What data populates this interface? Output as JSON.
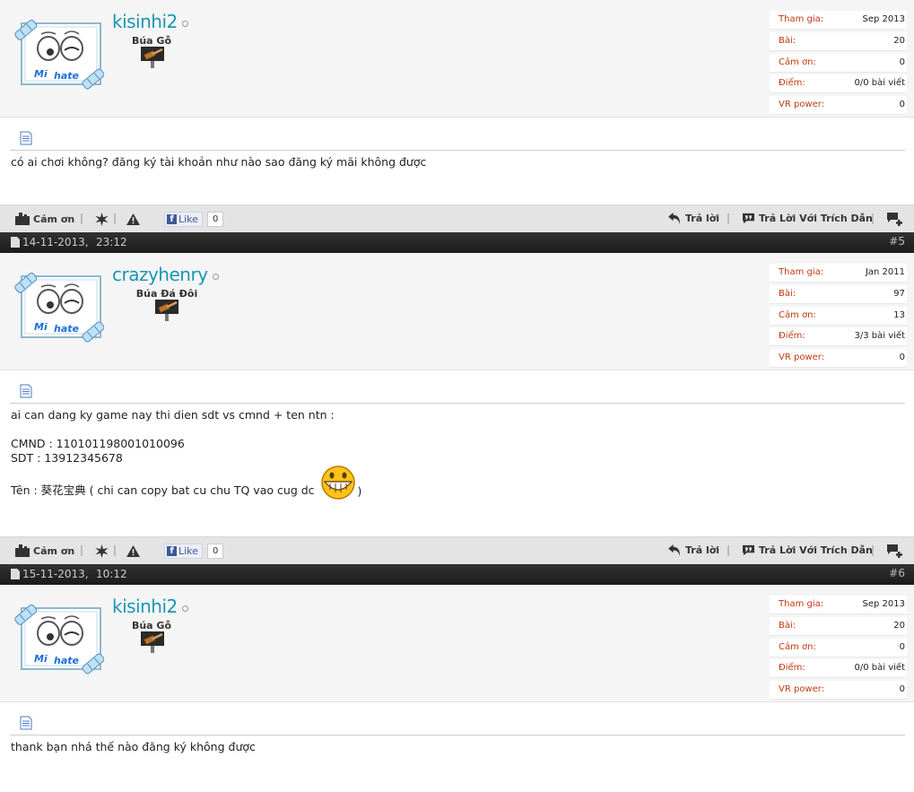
{
  "posts": [
    {
      "username": "kisinhi2",
      "user_title": "Búa Gỗ",
      "stats": [
        {
          "label": "Tham gia:",
          "value": "Sep 2013"
        },
        {
          "label": "Bài:",
          "value": "20"
        },
        {
          "label": "Cảm ơn:",
          "value": "0"
        },
        {
          "label": "Điểm:",
          "value": "0/0 bài viết"
        },
        {
          "label": "VR power:",
          "value": "0"
        }
      ],
      "content": [
        "có ai chơi không? đăng ký tài khoản như nào sao đăng ký mãi không được"
      ]
    },
    {
      "date": "14-11-2013,",
      "time": "23:12",
      "number": "#5",
      "username": "crazyhenry",
      "user_title": "Búa Đá Đôi",
      "stats": [
        {
          "label": "Tham gia:",
          "value": "Jan 2011"
        },
        {
          "label": "Bài:",
          "value": "97"
        },
        {
          "label": "Cảm ơn:",
          "value": "13"
        },
        {
          "label": "Điểm:",
          "value": "3/3 bài viết"
        },
        {
          "label": "VR power:",
          "value": "0"
        }
      ],
      "content": [
        "ai can dang ky game nay thi dien sdt vs cmnd + ten ntn :",
        "CMND : 110101198001010096",
        "SDT : 13912345678",
        "Tên : 葵花宝典 ( chi can copy bat cu chu TQ vao cug dc",
        ")"
      ]
    },
    {
      "date": "15-11-2013,",
      "time": "10:12",
      "number": "#6",
      "username": "kisinhi2",
      "user_title": "Búa Gỗ",
      "stats": [
        {
          "label": "Tham gia:",
          "value": "Sep 2013"
        },
        {
          "label": "Bài:",
          "value": "20"
        },
        {
          "label": "Cảm ơn:",
          "value": "0"
        },
        {
          "label": "Điểm:",
          "value": "0/0 bài viết"
        },
        {
          "label": "VR power:",
          "value": "0"
        }
      ],
      "content": [
        "thank bạn nhá thế nào đăng ký không được"
      ]
    }
  ],
  "footer": {
    "thanks_label": "Cảm ơn",
    "like_label": "Like",
    "like_count": "0",
    "reply_label": "Trả lời",
    "quote_label": "Trả Lời Với Trích Dẫn"
  },
  "colors": {
    "username": "#1996b3",
    "stat_label": "#c03a0e",
    "footer_bg": "#e4e4e4",
    "date_bar_bg": "#222222"
  },
  "icons": [
    "document-icon",
    "thanks-icon",
    "star-icon",
    "warning-icon",
    "facebook-icon",
    "reply-icon",
    "quote-icon",
    "multiquote-icon",
    "post-date-icon",
    "grin-smiley-icon",
    "hammer-rank-icon"
  ]
}
